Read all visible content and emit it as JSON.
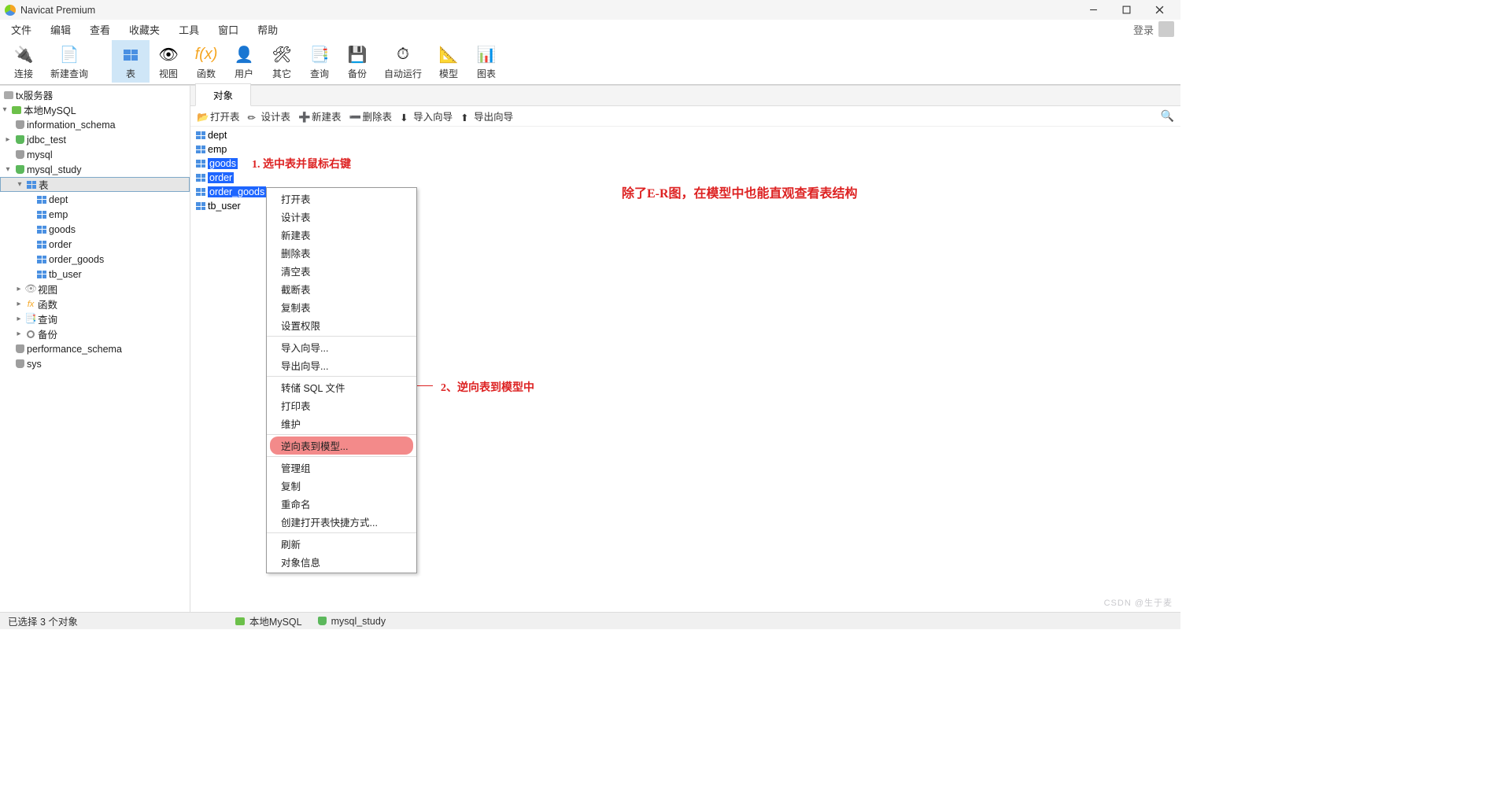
{
  "window": {
    "title": "Navicat Premium"
  },
  "menus": [
    "文件",
    "编辑",
    "查看",
    "收藏夹",
    "工具",
    "窗口",
    "帮助"
  ],
  "login_label": "登录",
  "toolbar": [
    {
      "name": "connect",
      "label": "连接"
    },
    {
      "name": "newquery",
      "label": "新建查询"
    },
    {
      "name": "table",
      "label": "表",
      "active": true
    },
    {
      "name": "view",
      "label": "视图"
    },
    {
      "name": "function",
      "label": "函数"
    },
    {
      "name": "user",
      "label": "用户"
    },
    {
      "name": "other",
      "label": "其它"
    },
    {
      "name": "query",
      "label": "查询"
    },
    {
      "name": "backup",
      "label": "备份"
    },
    {
      "name": "autorun",
      "label": "自动运行"
    },
    {
      "name": "model",
      "label": "模型"
    },
    {
      "name": "chart",
      "label": "图表"
    }
  ],
  "tree": {
    "n0": {
      "label": "tx服务器"
    },
    "n1": {
      "label": "本地MySQL"
    },
    "n2": {
      "label": "information_schema"
    },
    "n3": {
      "label": "jdbc_test"
    },
    "n4": {
      "label": "mysql"
    },
    "n5": {
      "label": "mysql_study"
    },
    "n6": {
      "label": "表"
    },
    "n7": {
      "label": "dept"
    },
    "n8": {
      "label": "emp"
    },
    "n9": {
      "label": "goods"
    },
    "n10": {
      "label": "order"
    },
    "n11": {
      "label": "order_goods"
    },
    "n12": {
      "label": "tb_user"
    },
    "n13": {
      "label": "视图"
    },
    "n14": {
      "label": "函数"
    },
    "n15": {
      "label": "查询"
    },
    "n16": {
      "label": "备份"
    },
    "n17": {
      "label": "performance_schema"
    },
    "n18": {
      "label": "sys"
    }
  },
  "tab": {
    "objects": "对象"
  },
  "subtoolbar": {
    "open": "打开表",
    "design": "设计表",
    "new": "新建表",
    "delete": "删除表",
    "import": "导入向导",
    "export": "导出向导"
  },
  "tables": [
    "dept",
    "emp",
    "goods",
    "order",
    "order_goods",
    "tb_user"
  ],
  "selected_tables": [
    "goods",
    "order",
    "order_goods"
  ],
  "context_menu": {
    "g1": [
      "打开表",
      "设计表",
      "新建表",
      "删除表",
      "清空表",
      "截断表",
      "复制表",
      "设置权限"
    ],
    "g2": [
      "导入向导...",
      "导出向导..."
    ],
    "g3": [
      "转储 SQL 文件",
      "打印表",
      "维护"
    ],
    "g4": [
      "逆向表到模型..."
    ],
    "g5": [
      "管理组",
      "复制",
      "重命名",
      "创建打开表快捷方式..."
    ],
    "g6": [
      "刷新",
      "对象信息"
    ]
  },
  "annotations": {
    "a1": "1. 选中表并鼠标右键",
    "a2": "2、逆向表到模型中",
    "a3": "除了E-R图，在模型中也能直观查看表结构"
  },
  "status": {
    "sel": "已选择 3 个对象",
    "conn": "本地MySQL",
    "db": "mysql_study"
  },
  "watermark": "CSDN @生于麦"
}
